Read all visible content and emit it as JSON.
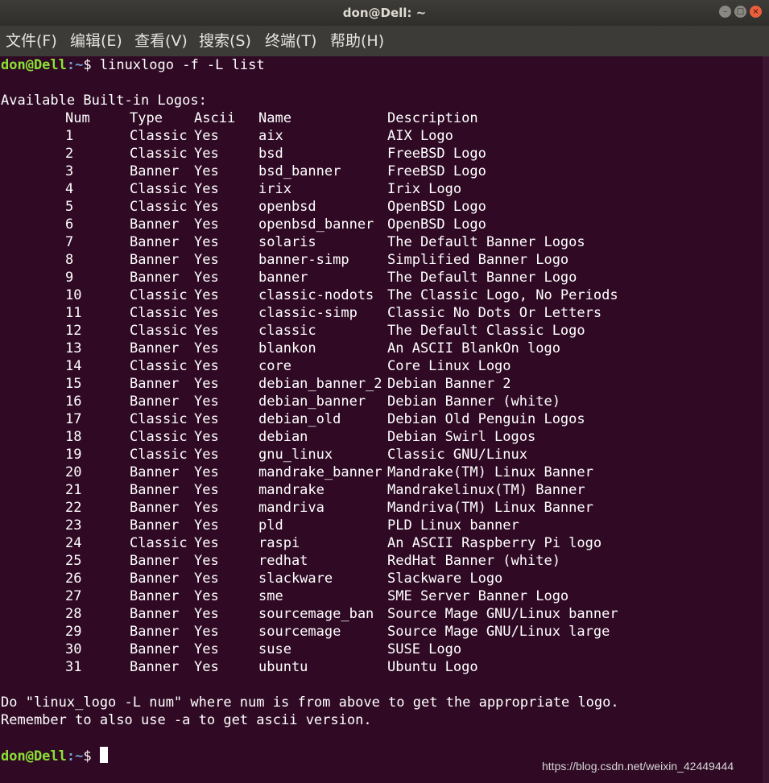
{
  "window": {
    "title": "don@Dell: ~",
    "buttons": [
      "–",
      "□",
      "×"
    ]
  },
  "menu": [
    "文件(F)",
    "编辑(E)",
    "查看(V)",
    "搜索(S)",
    "终端(T)",
    "帮助(H)"
  ],
  "prompt": {
    "user_host": "don@Dell",
    "path": ":~",
    "symbol": "$ "
  },
  "command": "linuxlogo -f -L list",
  "heading": "Available Built-in Logos:",
  "columns": [
    "Num",
    "Type",
    "Ascii",
    "Name",
    "Description"
  ],
  "logos": [
    [
      "1",
      "Classic",
      "Yes",
      "aix",
      "AIX Logo"
    ],
    [
      "2",
      "Classic",
      "Yes",
      "bsd",
      "FreeBSD Logo"
    ],
    [
      "3",
      "Banner",
      "Yes",
      "bsd_banner",
      "FreeBSD Logo"
    ],
    [
      "4",
      "Classic",
      "Yes",
      "irix",
      "Irix Logo"
    ],
    [
      "5",
      "Classic",
      "Yes",
      "openbsd",
      "OpenBSD Logo"
    ],
    [
      "6",
      "Banner",
      "Yes",
      "openbsd_banner",
      "OpenBSD Logo"
    ],
    [
      "7",
      "Banner",
      "Yes",
      "solaris",
      "The Default Banner Logos"
    ],
    [
      "8",
      "Banner",
      "Yes",
      "banner-simp",
      "Simplified Banner Logo"
    ],
    [
      "9",
      "Banner",
      "Yes",
      "banner",
      "The Default Banner Logo"
    ],
    [
      "10",
      "Classic",
      "Yes",
      "classic-nodots",
      "The Classic Logo, No Periods"
    ],
    [
      "11",
      "Classic",
      "Yes",
      "classic-simp",
      "Classic No Dots Or Letters"
    ],
    [
      "12",
      "Classic",
      "Yes",
      "classic",
      "The Default Classic Logo"
    ],
    [
      "13",
      "Banner",
      "Yes",
      "blankon",
      "An ASCII BlankOn logo"
    ],
    [
      "14",
      "Classic",
      "Yes",
      "core",
      "Core Linux Logo"
    ],
    [
      "15",
      "Banner",
      "Yes",
      "debian_banner_2",
      "Debian Banner 2"
    ],
    [
      "16",
      "Banner",
      "Yes",
      "debian_banner",
      "Debian Banner (white)"
    ],
    [
      "17",
      "Classic",
      "Yes",
      "debian_old",
      "Debian Old Penguin Logos"
    ],
    [
      "18",
      "Classic",
      "Yes",
      "debian",
      "Debian Swirl Logos"
    ],
    [
      "19",
      "Classic",
      "Yes",
      "gnu_linux",
      "Classic GNU/Linux"
    ],
    [
      "20",
      "Banner",
      "Yes",
      "mandrake_banner",
      "Mandrake(TM) Linux Banner"
    ],
    [
      "21",
      "Banner",
      "Yes",
      "mandrake",
      "Mandrakelinux(TM) Banner"
    ],
    [
      "22",
      "Banner",
      "Yes",
      "mandriva",
      "Mandriva(TM) Linux Banner"
    ],
    [
      "23",
      "Banner",
      "Yes",
      "pld",
      "PLD Linux banner"
    ],
    [
      "24",
      "Classic",
      "Yes",
      "raspi",
      "An ASCII Raspberry Pi logo"
    ],
    [
      "25",
      "Banner",
      "Yes",
      "redhat",
      "RedHat Banner (white)"
    ],
    [
      "26",
      "Banner",
      "Yes",
      "slackware",
      "Slackware Logo"
    ],
    [
      "27",
      "Banner",
      "Yes",
      "sme",
      "SME Server Banner Logo"
    ],
    [
      "28",
      "Banner",
      "Yes",
      "sourcemage_ban",
      "Source Mage GNU/Linux banner"
    ],
    [
      "29",
      "Banner",
      "Yes",
      "sourcemage",
      "Source Mage GNU/Linux large"
    ],
    [
      "30",
      "Banner",
      "Yes",
      "suse",
      "SUSE Logo"
    ],
    [
      "31",
      "Banner",
      "Yes",
      "ubuntu",
      "Ubuntu Logo"
    ]
  ],
  "footer": [
    "Do \"linux_logo -L num\" where num is from above to get the appropriate logo.",
    "Remember to also use -a to get ascii version."
  ],
  "watermark": "https://blog.csdn.net/weixin_42449444",
  "colors": {
    "background": "#300a24",
    "user": "#8ae234",
    "path": "#729fcf",
    "text": "#ffffff"
  }
}
